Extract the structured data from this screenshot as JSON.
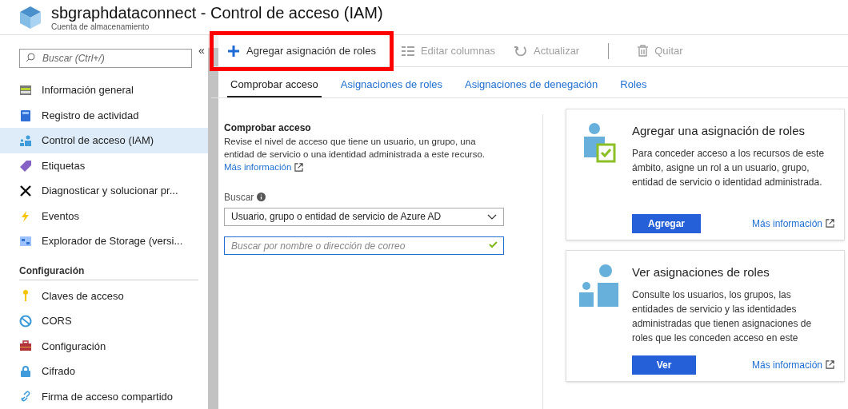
{
  "header": {
    "title": "sbgraphdataconnect - Control de acceso (IAM)",
    "subtitle": "Cuenta de almacenamiento"
  },
  "sidebar": {
    "search": {
      "placeholder": "Buscar (Ctrl+/)"
    },
    "collapse": "«",
    "items": [
      {
        "label": "Información general",
        "selected": false
      },
      {
        "label": "Registro de actividad",
        "selected": false
      },
      {
        "label": "Control de acceso (IAM)",
        "selected": true
      },
      {
        "label": "Etiquetas",
        "selected": false
      },
      {
        "label": "Diagnosticar y solucionar pr...",
        "selected": false
      },
      {
        "label": "Eventos",
        "selected": false
      },
      {
        "label": "Explorador de Storage (versi...",
        "selected": false
      }
    ],
    "section": "Configuración",
    "section_items": [
      {
        "label": "Claves de acceso",
        "selected": false
      },
      {
        "label": "CORS",
        "selected": false
      },
      {
        "label": "Configuración",
        "selected": false
      },
      {
        "label": "Cifrado",
        "selected": false
      },
      {
        "label": "Firma de acceso compartido",
        "selected": false
      }
    ]
  },
  "toolbar": [
    {
      "label": "Agregar asignación de roles",
      "disabled": false,
      "highlighted": true
    },
    {
      "label": "Editar columnas",
      "disabled": true,
      "highlighted": false
    },
    {
      "label": "Actualizar",
      "disabled": true,
      "highlighted": false
    },
    {
      "label": "Quitar",
      "disabled": true,
      "highlighted": false
    }
  ],
  "tabs": [
    {
      "label": "Comprobar acceso",
      "selected": true
    },
    {
      "label": "Asignaciones de roles",
      "selected": false
    },
    {
      "label": "Asignaciones de denegación",
      "selected": false
    },
    {
      "label": "Roles",
      "selected": false
    }
  ],
  "check_access": {
    "title": "Comprobar acceso",
    "description": "Revise el nivel de acceso que tiene un usuario, un grupo, una entidad de servicio o una identidad administrada a este recurso.",
    "link": "Más información",
    "search_label": "Buscar",
    "dropdown": "Usuario, grupo o entidad de servicio de Azure AD",
    "search": {
      "placeholder": "Buscar por nombre o dirección de correo"
    }
  },
  "cards": [
    {
      "title": "Agregar una asignación de roles",
      "description": "Para conceder acceso a los recursos de este ámbito, asigne un rol a un usuario, grupo, entidad de servicio o identidad administrada.",
      "button": "Agregar",
      "link": "Más información"
    },
    {
      "title": "Ver asignaciones de roles",
      "description": "Consulte los usuarios, los grupos, las entidades de servicio y las identidades administradas que tienen asignaciones de roles que les conceden acceso en este",
      "button": "Ver",
      "link": "Más información"
    }
  ]
}
